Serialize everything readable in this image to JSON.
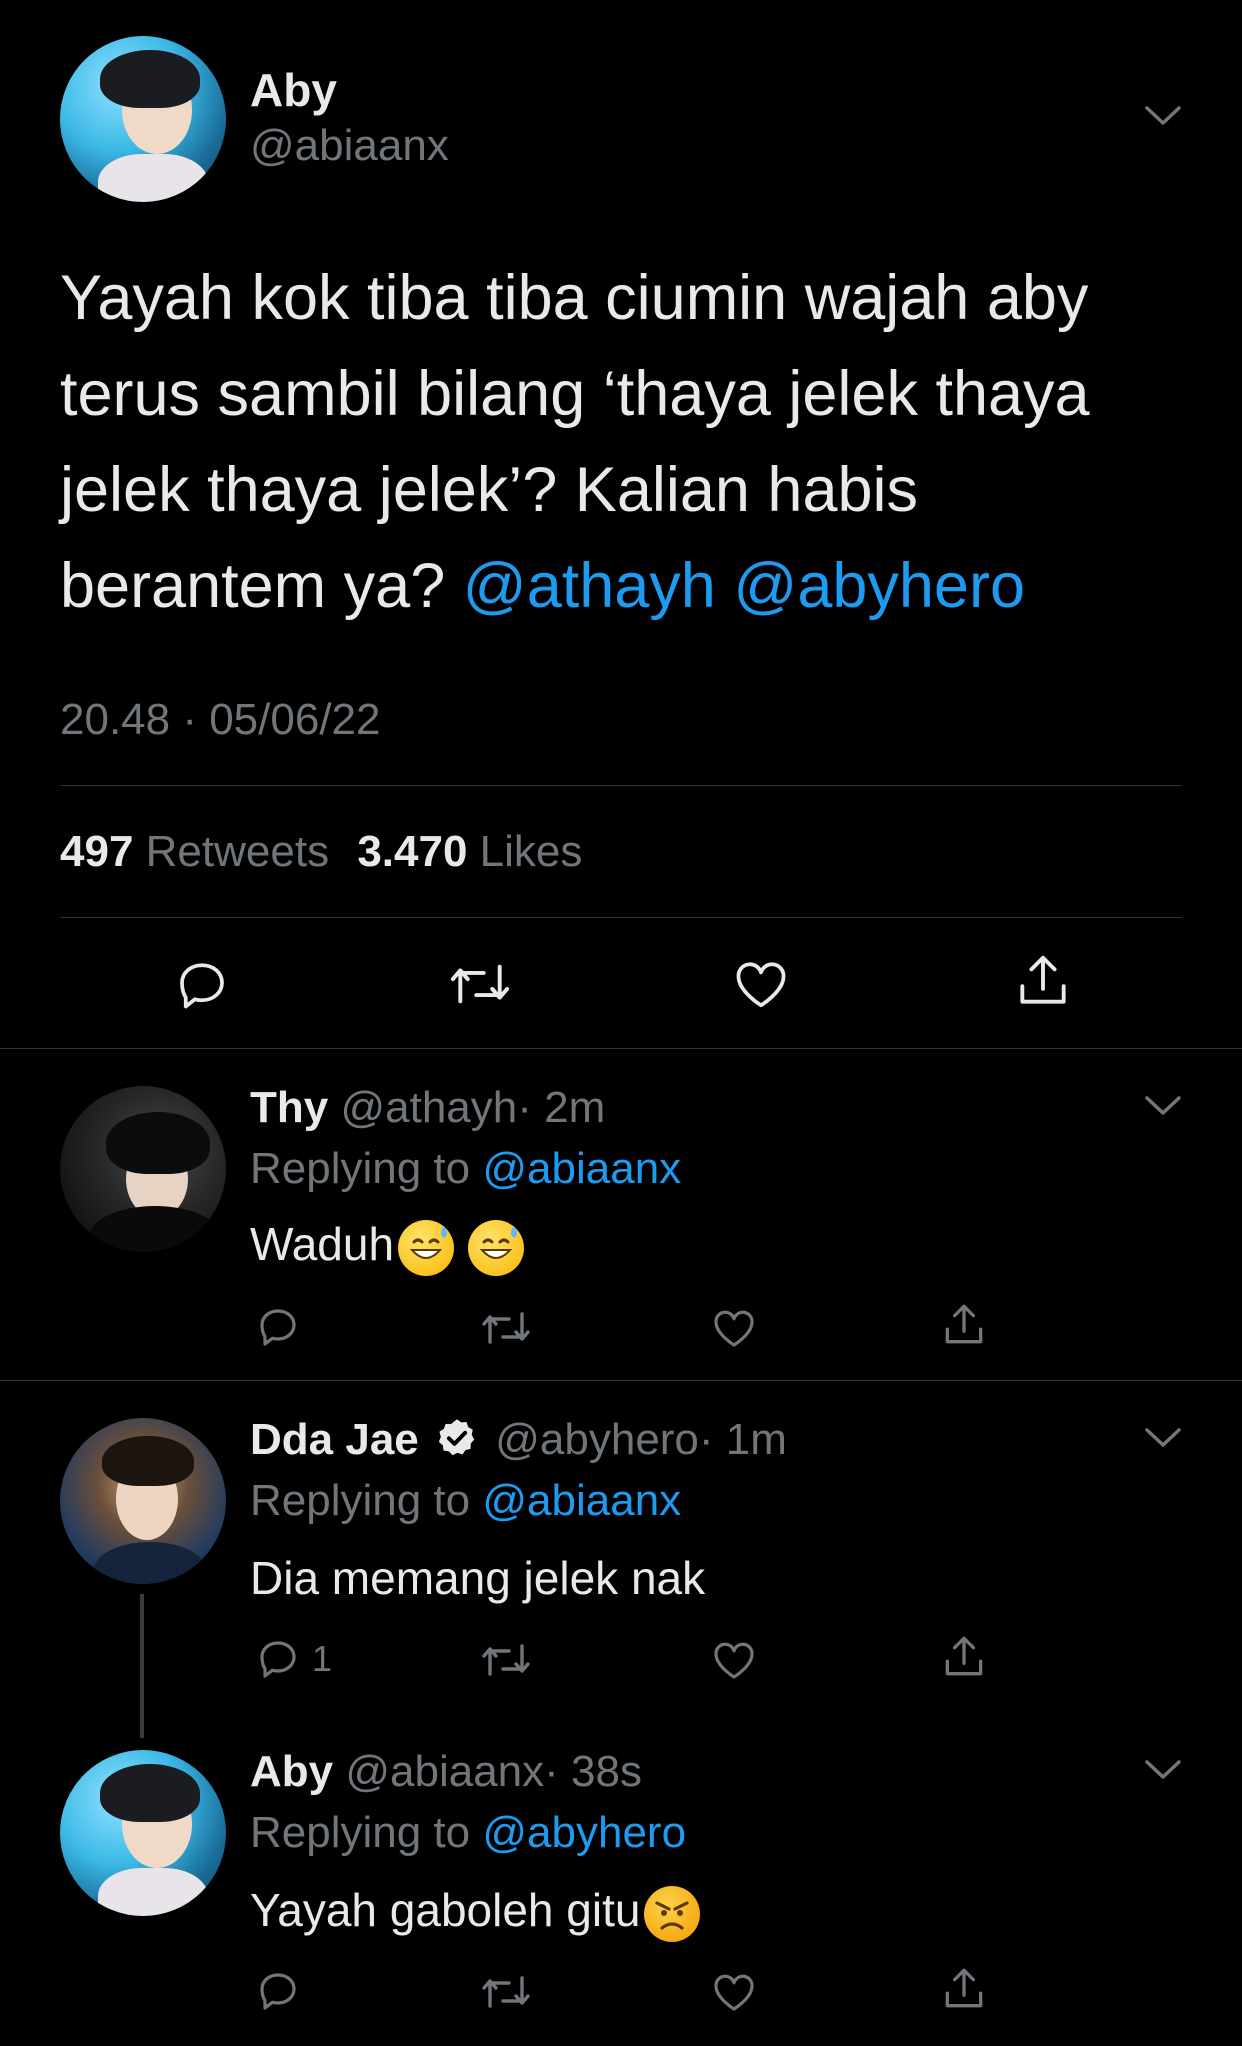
{
  "main_tweet": {
    "author_name": "Aby",
    "author_handle": "@abiaanx",
    "text_lines": [
      "Yayah kok tiba tiba ciumin wajah aby",
      "terus sambil bilang ‘thaya jelek thaya",
      "jelek thaya jelek’? Kalian habis"
    ],
    "text_last_plain": "berantem ya? ",
    "mention1": "@athayh",
    "mention2": "@abyhero",
    "timestamp": "20.48 · 05/06/22",
    "retweets_count": "497",
    "retweets_label": "Retweets",
    "likes_count": "3.470",
    "likes_label": "Likes"
  },
  "replies": [
    {
      "author_name": "Thy",
      "author_handle": "@athayh",
      "time": "· 2m",
      "replying_label": "Replying to",
      "replying_to": "@abiaanx",
      "text": "Waduh",
      "reply_count": ""
    },
    {
      "author_name": "Dda Jae",
      "author_handle": "@abyhero",
      "time": "· 1m",
      "replying_label": "Replying to",
      "replying_to": "@abiaanx",
      "text": "Dia memang jelek nak",
      "reply_count": "1"
    },
    {
      "author_name": "Aby",
      "author_handle": "@abiaanx",
      "time": "· 38s",
      "replying_label": "Replying to",
      "replying_to": "@abyhero",
      "text": "Yayah gaboleh gitu",
      "reply_count": ""
    }
  ],
  "icons": [
    "chevron-down-icon",
    "reply-icon",
    "retweet-icon",
    "like-icon",
    "share-icon",
    "verified-badge-icon",
    "grinning-sweat-emoji",
    "angry-emoji"
  ],
  "colors": {
    "background": "#000000",
    "text": "#e7e9ea",
    "muted": "#71767b",
    "link": "#1d9bf0",
    "divider": "#2f3336"
  }
}
